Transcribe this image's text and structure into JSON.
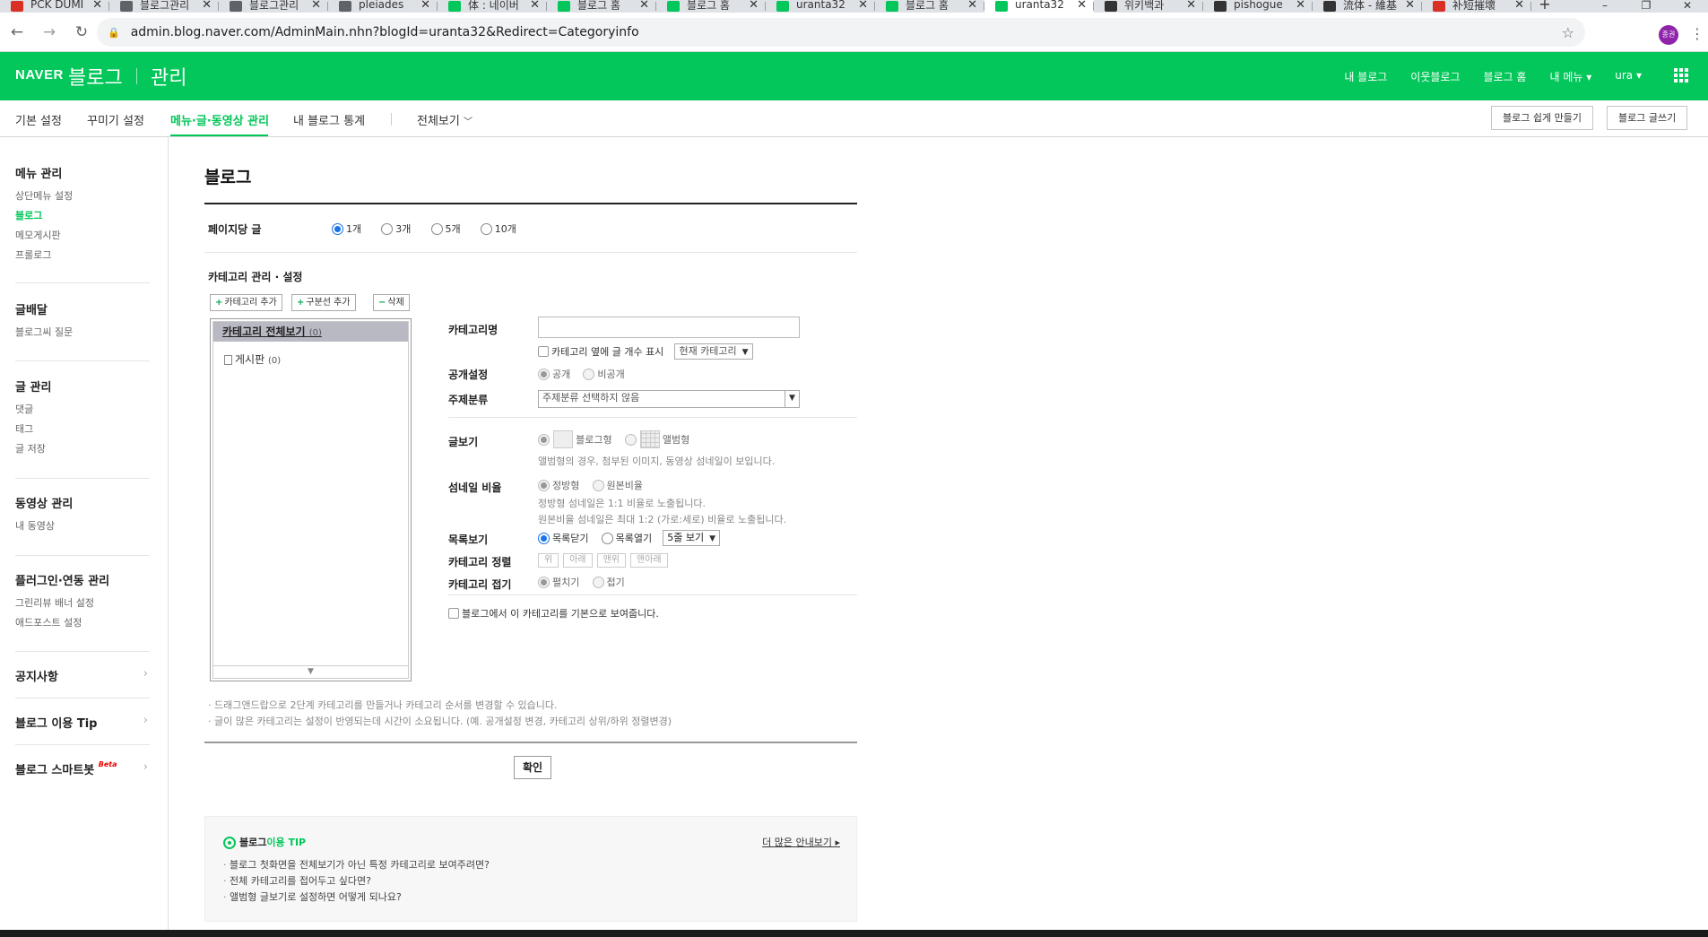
{
  "browser": {
    "tabs": [
      {
        "label": "PCK DUMI",
        "color": "#d93025",
        "active": false
      },
      {
        "label": "블로그관리",
        "color": "#5f6368",
        "active": false
      },
      {
        "label": "블로그관리",
        "color": "#5f6368",
        "active": false
      },
      {
        "label": "pleiades",
        "color": "#5f6368",
        "active": false
      },
      {
        "label": "体 : 네이버",
        "color": "#03c75a",
        "active": false
      },
      {
        "label": "블로그 홈",
        "color": "#03c75a",
        "active": false
      },
      {
        "label": "블로그 홈",
        "color": "#03c75a",
        "active": false
      },
      {
        "label": "uranta32",
        "color": "#03c75a",
        "active": false
      },
      {
        "label": "블로그 홈",
        "color": "#03c75a",
        "active": false
      },
      {
        "label": "uranta32",
        "color": "#03c75a",
        "active": true
      },
      {
        "label": "위키백과",
        "color": "#333333",
        "active": false
      },
      {
        "label": "pishogue",
        "color": "#333333",
        "active": false
      },
      {
        "label": "流体 - 維基",
        "color": "#333333",
        "active": false
      },
      {
        "label": "补短摧壞",
        "color": "#d93025",
        "active": false
      }
    ],
    "url": "admin.blog.naver.com/AdminMain.nhn?blogId=uranta32&Redirect=Categoryinfo",
    "profile_initials": "종권"
  },
  "header": {
    "logo": "NAVER",
    "blog": "블로그",
    "admin": "관리",
    "menu": [
      "내 블로그",
      "이웃블로그",
      "블로그 홈",
      "내 메뉴 ▾",
      "ura ▾"
    ]
  },
  "subnav": {
    "items": [
      "기본 설정",
      "꾸미기 설정",
      "메뉴·글·동영상 관리",
      "내 블로그 통계"
    ],
    "view_all": "전체보기",
    "btn_easy": "블로그 쉽게 만들기",
    "btn_write": "블로그 글쓰기"
  },
  "sidebar": {
    "menu_title": "메뉴 관리",
    "menu_items": [
      "상단메뉴 설정",
      "블로그",
      "메모게시판",
      "프롤로그"
    ],
    "dist_title": "글배달",
    "dist_items": [
      "블로그씨 질문"
    ],
    "post_title": "글 관리",
    "post_items": [
      "댓글",
      "태그",
      "글 저장"
    ],
    "video_title": "동영상 관리",
    "video_items": [
      "내 동영상"
    ],
    "plugin_title": "플러그인·연동 관리",
    "plugin_items": [
      "그린리뷰 배너 설정",
      "애드포스트 설정"
    ],
    "notice": "공지사항",
    "tip": "블로그 이용 Tip",
    "smartbot": "블로그 스마트봇",
    "beta": "Beta"
  },
  "main": {
    "title": "블로그",
    "per_page_label": "페이지당 글",
    "per_page_options": [
      "1개",
      "3개",
      "5개",
      "10개"
    ],
    "cat_title": "카테고리 관리 · 설정",
    "btn_add_cat": "카테고리 추가",
    "btn_add_div": "구분선 추가",
    "btn_delete": "삭제",
    "cat_all": "카테고리 전체보기",
    "cat_all_count": "(0)",
    "cat_board": "게시판",
    "cat_board_count": "(0)",
    "f_name_label": "카테고리명",
    "f_show_count": "카테고리 옆에 글 개수 표시",
    "f_current_cat": "현재 카테고리",
    "f_public_label": "공개설정",
    "f_public": "공개",
    "f_private": "비공개",
    "f_topic_label": "주제분류",
    "f_topic_value": "주제분류 선택하지 않음",
    "f_view_label": "글보기",
    "f_view_blog": "블로그형",
    "f_view_album": "앨범형",
    "f_view_help": "앨범형의 경우, 첨부된 이미지, 동영상 섬네일이 보입니다.",
    "f_thumb_label": "섬네일 비율",
    "f_thumb_square": "정방형",
    "f_thumb_orig": "원본비율",
    "f_thumb_help1": "정방형 섬네일은 1:1 비율로 노출됩니다.",
    "f_thumb_help2": "원본비율 섬네일은 최대 1:2 (가로:세로) 비율로 노출됩니다.",
    "f_list_label": "목록보기",
    "f_list_close": "목록닫기",
    "f_list_open": "목록열기",
    "f_list_rows": "5줄 보기",
    "f_sort_label": "카테고리 정렬",
    "f_sort_btns": [
      "위",
      "아래",
      "맨위",
      "맨아래"
    ],
    "f_fold_label": "카테고리 접기",
    "f_fold_open": "펼치기",
    "f_fold_close": "접기",
    "f_default": "블로그에서 이 카테고리를 기본으로 보여줍니다.",
    "note1": "· 드래그앤드랍으로 2단계 카테고리를 만들거나 카테고리 순서를 변경할 수 있습니다.",
    "note2": "· 글이 많은 카테고리는 설정이 반영되는데 시간이 소요됩니다. (예. 공개설정 변경, 카테고리 상위/하위 정렬변경)",
    "ok": "확인"
  },
  "tip": {
    "title_a": "블로그",
    "title_b": "이용 TIP",
    "more": "더 많은 안내보기 ▸",
    "items": [
      "블로그 첫화면을 전체보기가 아닌 특정 카테고리로 보여주려면?",
      "전체 카테고리를 접어두고 싶다면?",
      "앨범형 글보기로 설정하면 어떻게 되나요?"
    ]
  }
}
